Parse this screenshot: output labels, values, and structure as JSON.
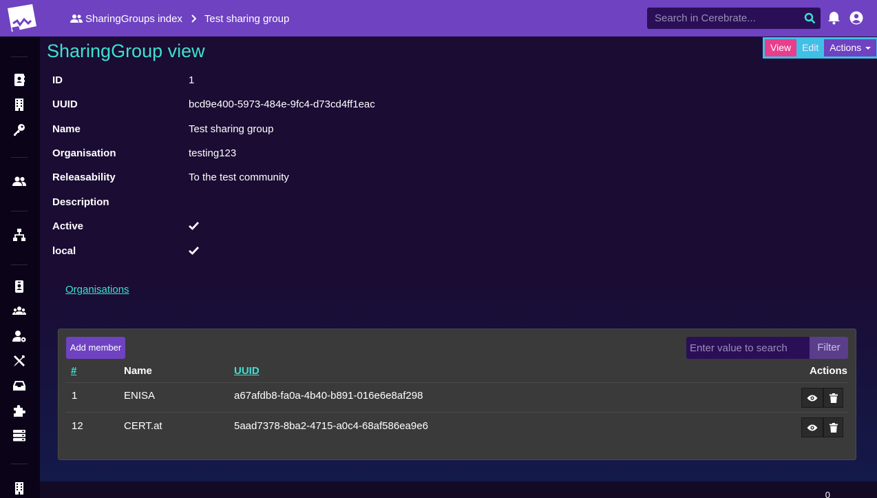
{
  "header": {
    "breadcrumb": [
      {
        "label": "SharingGroups index",
        "icon": "users-icon"
      },
      {
        "label": "Test sharing group"
      }
    ],
    "search_placeholder": "Search in Cerebrate...",
    "colors": {
      "navbar": "#6f42c1",
      "accent": "#3fe0d0"
    }
  },
  "sidebar": {
    "icons": [
      "address-card-icon",
      "building-icon",
      "key-icon",
      "users-icon",
      "sitemap-icon",
      "id-badge-icon",
      "user-group-icon",
      "user-cog-icon",
      "tools-icon",
      "inbox-icon",
      "puzzle-icon",
      "server-icon",
      "building-icon"
    ]
  },
  "page": {
    "title": "SharingGroup view",
    "actions": {
      "view": "View",
      "edit": "Edit",
      "actions": "Actions"
    }
  },
  "fields": [
    {
      "label": "ID",
      "value": "1"
    },
    {
      "label": "UUID",
      "value": "bcd9e400-5973-484e-9fc4-d73cd4ff1eac"
    },
    {
      "label": "Name",
      "value": "Test sharing group"
    },
    {
      "label": "Organisation",
      "value": "testing123"
    },
    {
      "label": "Releasability",
      "value": "To the test community"
    },
    {
      "label": "Description",
      "value": ""
    },
    {
      "label": "Active",
      "value": "check-icon"
    },
    {
      "label": "local",
      "value": "check-icon"
    }
  ],
  "tab": {
    "label": "Organisations"
  },
  "members": {
    "add_label": "Add member",
    "filter_placeholder": "Enter value to search",
    "filter_label": "Filter",
    "columns": {
      "num": "#",
      "name": "Name",
      "uuid": "UUID",
      "actions": "Actions"
    },
    "rows": [
      {
        "num": "1",
        "name": "ENISA",
        "uuid": "a67afdb8-fa0a-4b40-b891-016e6e8af298"
      },
      {
        "num": "12",
        "name": "CERT.at",
        "uuid": "5aad7378-8ba2-4715-a0c4-68af586ea9e6"
      }
    ]
  },
  "footer": {
    "counter": "0"
  }
}
